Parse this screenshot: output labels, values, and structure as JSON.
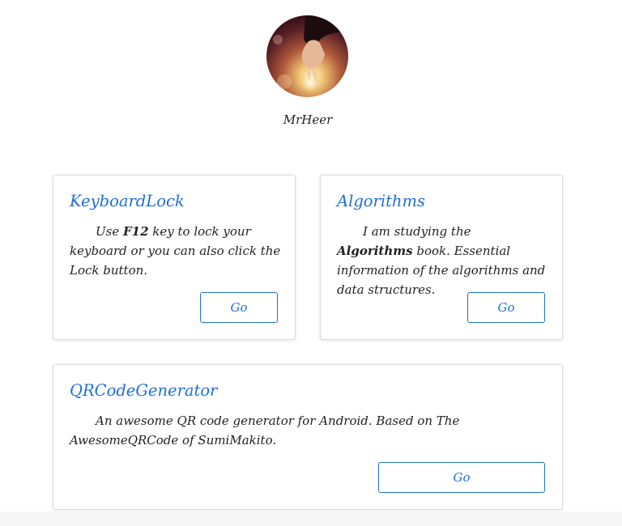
{
  "profile": {
    "username": "MrHeer"
  },
  "cards": [
    {
      "title": "KeyboardLock",
      "desc_before": "Use ",
      "desc_bold": "F12",
      "desc_after": " key to lock your keyboard or you can also click the Lock button.",
      "button_label": "Go"
    },
    {
      "title": "Algorithms",
      "desc_before": "I am studying the ",
      "desc_bold": "Algorithms",
      "desc_after": " book. Essential information of the algorithms and data structures.",
      "button_label": "Go"
    },
    {
      "title": "QRCodeGenerator",
      "desc_before": "An awesome QR code generator for Android. Based on The AwesomeQRCode of SumiMakito.",
      "desc_bold": "",
      "desc_after": "",
      "button_label": "Go"
    }
  ],
  "colors": {
    "accent": "#1f6fd4",
    "text": "#222222",
    "card_border": "#dcdcdc"
  }
}
